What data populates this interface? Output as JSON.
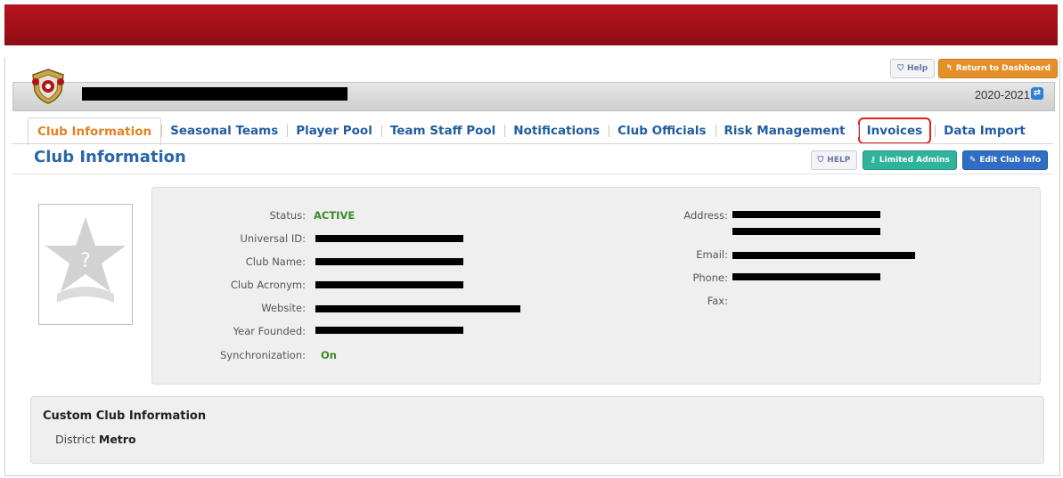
{
  "utility": {
    "help_label": "Help",
    "dashboard_label": "Return to Dashboard"
  },
  "header": {
    "season": "2020-2021"
  },
  "tabs": [
    {
      "label": "Club Information",
      "active": true
    },
    {
      "label": "Seasonal Teams"
    },
    {
      "label": "Player Pool"
    },
    {
      "label": "Team Staff Pool"
    },
    {
      "label": "Notifications"
    },
    {
      "label": "Club Officials"
    },
    {
      "label": "Risk Management"
    },
    {
      "label": "Invoices",
      "highlighted": true
    },
    {
      "label": "Data Import"
    }
  ],
  "section": {
    "title": "Club Information",
    "help_label": "HELP",
    "limited_admins_label": "Limited Admins",
    "edit_label": "Edit Club Info"
  },
  "info_left": {
    "status_label": "Status:",
    "status_value": "ACTIVE",
    "universal_id_label": "Universal ID:",
    "club_name_label": "Club Name:",
    "club_acronym_label": "Club Acronym:",
    "website_label": "Website:",
    "year_founded_label": "Year Founded:",
    "sync_label": "Synchronization:",
    "sync_value": "On"
  },
  "info_right": {
    "address_label": "Address:",
    "email_label": "Email:",
    "phone_label": "Phone:",
    "fax_label": "Fax:"
  },
  "custom": {
    "title": "Custom Club Information",
    "district_label": "District",
    "district_value": "Metro"
  },
  "colors": {
    "banner": "#a01018",
    "tab_text": "#1f5d9f",
    "active_tab": "#e08420",
    "invoices_outline": "#e02020",
    "status_green": "#3a8a2a"
  },
  "icons": [
    "club-crest-icon",
    "help-icon",
    "return-arrow-icon",
    "season-switch-icon",
    "key-icon",
    "pencil-icon",
    "placeholder-star-icon"
  ]
}
